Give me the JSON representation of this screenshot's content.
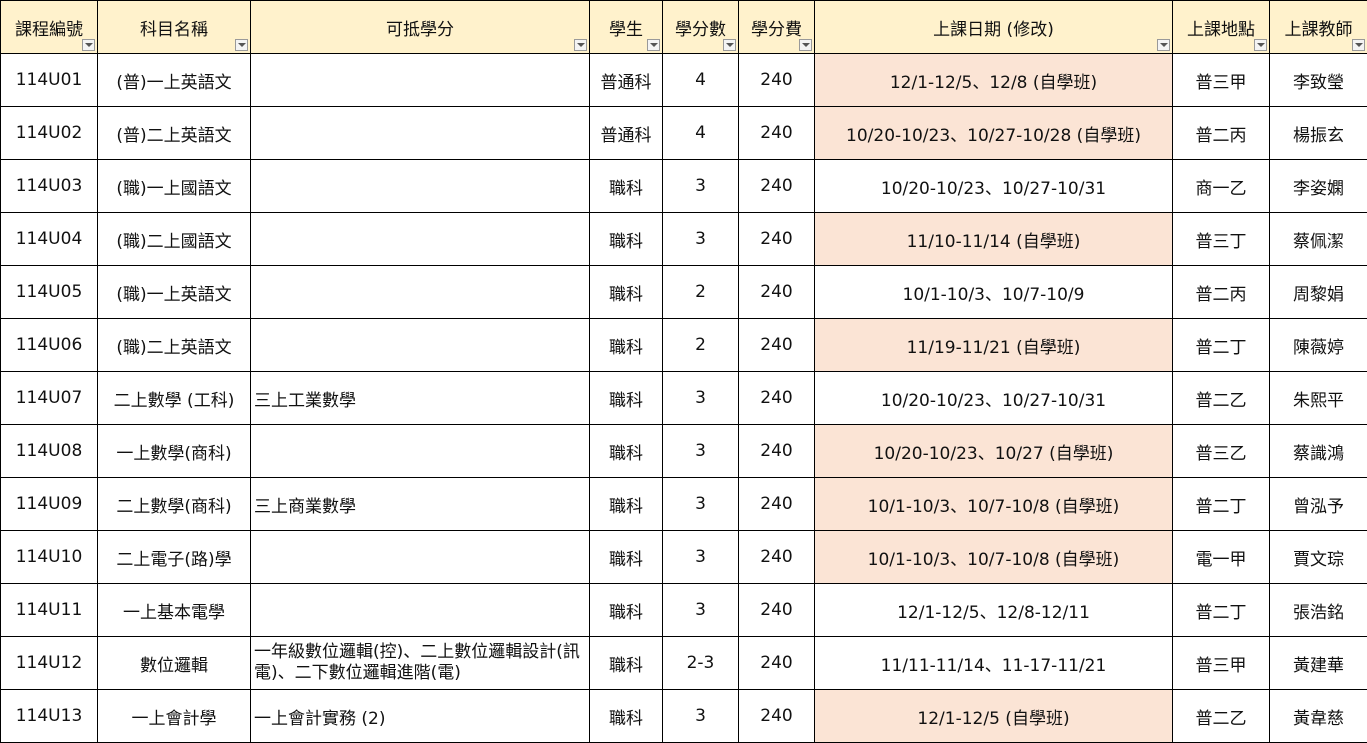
{
  "headers": [
    "課程編號",
    "科目名稱",
    "可抵學分",
    "學生",
    "學分數",
    "學分費",
    "上課日期 (修改)",
    "上課地點",
    "上課教師"
  ],
  "filter_icon": "dropdown-arrow-icon",
  "highlight_color": "#fbe4d5",
  "header_color": "#fff2cc",
  "rows": [
    {
      "code": "114U01",
      "subject": "(普)一上英語文",
      "credit_transfer": "",
      "student": "普通科",
      "credits": "4",
      "fee": "240",
      "dates": "12/1-12/5、12/8 (自學班)",
      "location": "普三甲",
      "teacher": "李致瑩",
      "highlight": true
    },
    {
      "code": "114U02",
      "subject": "(普)二上英語文",
      "credit_transfer": "",
      "student": "普通科",
      "credits": "4",
      "fee": "240",
      "dates": "10/20-10/23、10/27-10/28 (自學班)",
      "location": "普二丙",
      "teacher": "楊振玄",
      "highlight": true
    },
    {
      "code": "114U03",
      "subject": "(職)一上國語文",
      "credit_transfer": "",
      "student": "職科",
      "credits": "3",
      "fee": "240",
      "dates": "10/20-10/23、10/27-10/31",
      "location": "商一乙",
      "teacher": "李姿嫻",
      "highlight": false
    },
    {
      "code": "114U04",
      "subject": "(職)二上國語文",
      "credit_transfer": "",
      "student": "職科",
      "credits": "3",
      "fee": "240",
      "dates": "11/10-11/14 (自學班)",
      "location": "普三丁",
      "teacher": "蔡佩潔",
      "highlight": true
    },
    {
      "code": "114U05",
      "subject": "(職)一上英語文",
      "credit_transfer": "",
      "student": "職科",
      "credits": "2",
      "fee": "240",
      "dates": "10/1-10/3、10/7-10/9",
      "location": "普二丙",
      "teacher": "周黎娟",
      "highlight": false
    },
    {
      "code": "114U06",
      "subject": "(職)二上英語文",
      "credit_transfer": "",
      "student": "職科",
      "credits": "2",
      "fee": "240",
      "dates": "11/19-11/21 (自學班)",
      "location": "普二丁",
      "teacher": "陳薇婷",
      "highlight": true
    },
    {
      "code": "114U07",
      "subject": "二上數學 (工科)",
      "credit_transfer": "三上工業數學",
      "student": "職科",
      "credits": "3",
      "fee": "240",
      "dates": "10/20-10/23、10/27-10/31",
      "location": "普二乙",
      "teacher": "朱熙平",
      "highlight": false
    },
    {
      "code": "114U08",
      "subject": "一上數學(商科)",
      "credit_transfer": "",
      "student": "職科",
      "credits": "3",
      "fee": "240",
      "dates": "10/20-10/23、10/27 (自學班)",
      "location": "普三乙",
      "teacher": "蔡識鴻",
      "highlight": true
    },
    {
      "code": "114U09",
      "subject": "二上數學(商科)",
      "credit_transfer": "三上商業數學",
      "student": "職科",
      "credits": "3",
      "fee": "240",
      "dates": "10/1-10/3、10/7-10/8 (自學班)",
      "location": "普二丁",
      "teacher": "曾泓予",
      "highlight": true
    },
    {
      "code": "114U10",
      "subject": "二上電子(路)學",
      "credit_transfer": "",
      "student": "職科",
      "credits": "3",
      "fee": "240",
      "dates": "10/1-10/3、10/7-10/8 (自學班)",
      "location": "電一甲",
      "teacher": "賈文琮",
      "highlight": true
    },
    {
      "code": "114U11",
      "subject": "一上基本電學",
      "credit_transfer": "",
      "student": "職科",
      "credits": "3",
      "fee": "240",
      "dates": "12/1-12/5、12/8-12/11",
      "location": "普二丁",
      "teacher": "張浩銘",
      "highlight": false
    },
    {
      "code": "114U12",
      "subject": "數位邏輯",
      "credit_transfer": "一年級數位邏輯(控)、二上數位邏輯設計(訊電)、二下數位邏輯進階(電)",
      "student": "職科",
      "credits": "2-3",
      "fee": "240",
      "dates": "11/11-11/14、11-17-11/21",
      "location": "普三甲",
      "teacher": "黃建華",
      "highlight": false
    },
    {
      "code": "114U13",
      "subject": "一上會計學",
      "credit_transfer": "一上會計實務 (2)",
      "student": "職科",
      "credits": "3",
      "fee": "240",
      "dates": "12/1-12/5 (自學班)",
      "location": "普二乙",
      "teacher": "黃韋慈",
      "highlight": true
    }
  ]
}
